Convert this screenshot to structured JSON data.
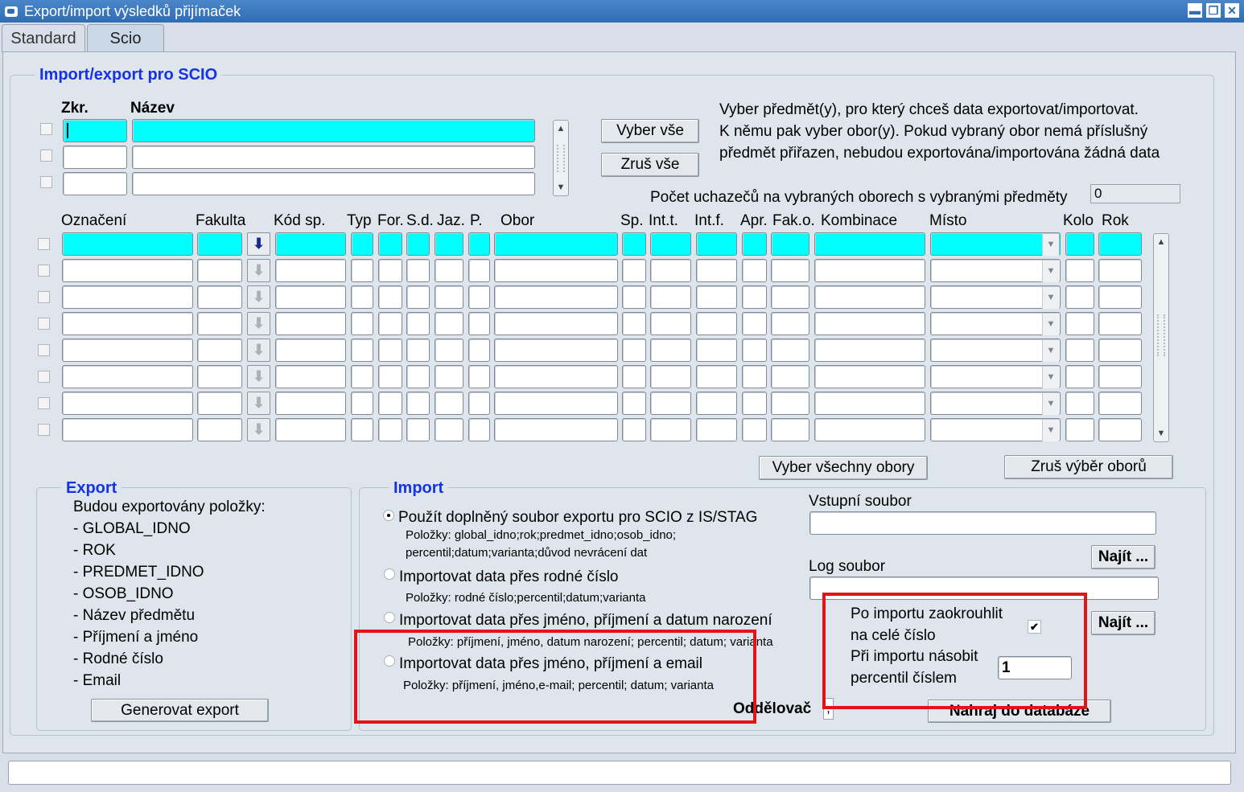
{
  "window": {
    "title": "Export/import výsledků přijímaček"
  },
  "tabs": [
    {
      "label": "Standard"
    },
    {
      "label": "Scio"
    }
  ],
  "section_main": {
    "label": "Import/export pro SCIO"
  },
  "subjects": {
    "col_zkr": "Zkr.",
    "col_nazev": "Název",
    "btn_select_all": "Vyber vše",
    "btn_clear_all": "Zruš vše",
    "info_line1": "Vyber předmět(y), pro který chceš data exportovat/importovat.",
    "info_line2": "K němu pak vyber obor(y). Pokud vybraný obor nemá příslušný",
    "info_line3": "předmět přiřazen, nebudou exportována/importována žádná data",
    "count_label": "Počet uchazečů na vybraných oborech s vybranými předměty",
    "count_value": "0"
  },
  "fields_table": {
    "headers": {
      "oznaceni": "Označení",
      "fakulta": "Fakulta",
      "kod_sp": "Kód sp.",
      "typ": "Typ",
      "for": "For.",
      "sd": "S.d.",
      "jaz": "Jaz.",
      "p": "P.",
      "obor": "Obor",
      "sp": "Sp.",
      "int_t": "Int.t.",
      "int_f": "Int.f.",
      "apr": "Apr.",
      "fak_o": "Fak.o.",
      "kombinace": "Kombinace",
      "misto": "Místo",
      "kolo": "Kolo",
      "rok": "Rok"
    },
    "btn_select_all_fields": "Vyber všechny obory",
    "btn_clear_fields": "Zruš výběr oborů"
  },
  "export": {
    "label": "Export",
    "intro": "Budou exportovány položky:",
    "items": [
      "- GLOBAL_IDNO",
      "- ROK",
      "- PREDMET_IDNO",
      "- OSOB_IDNO",
      "- Název předmětu",
      "- Příjmení a jméno",
      "- Rodné číslo",
      "- Email"
    ],
    "btn_generate": "Generovat export"
  },
  "import": {
    "label": "Import",
    "options": [
      {
        "label": "Použít doplněný soubor exportu pro SCIO z IS/STAG",
        "items_line1": "Položky: global_idno;rok;predmet_idno;osob_idno;",
        "items_line2": "percentil;datum;varianta;důvod nevrácení dat",
        "selected": true
      },
      {
        "label": "Importovat data přes rodné číslo",
        "items_line1": "Položky: rodné číslo;percentil;datum;varianta",
        "selected": false
      },
      {
        "label": "Importovat data přes jméno, příjmení a datum narození",
        "items_line1": "Položky: příjmení, jméno, datum narození; percentil; datum; varianta",
        "selected": false
      },
      {
        "label": "Importovat data přes jméno, příjmení a email",
        "items_line1": "Položky: příjmení, jméno,e-mail; percentil; datum; varianta",
        "selected": false
      }
    ],
    "input_file_label": "Vstupní soubor",
    "input_file_value": "",
    "btn_find1": "Najít ...",
    "log_file_label": "Log soubor",
    "log_file_value": "",
    "btn_find2": "Najít ...",
    "round_label1": "Po importu zaokrouhlit",
    "round_label2": "na celé číslo",
    "round_checked": true,
    "check_mark": "✔",
    "multiply_label1": "Při importu násobit",
    "multiply_label2": "percentil číslem",
    "multiply_value": "1",
    "separator_label": "Oddělovač",
    "separator_value": ",",
    "btn_load_db": "Nahraj do databáze"
  },
  "icons": {
    "download": "⬇",
    "arrow_up": "▲",
    "arrow_down": "▼",
    "minimize": "▬",
    "restore": "❐",
    "close": "✕"
  },
  "colors": {
    "highlight_cyan": "#00ffff",
    "group_label_blue": "#1432e6",
    "annotation_red": "#e11515",
    "titlebar": "#2f6cb4"
  }
}
